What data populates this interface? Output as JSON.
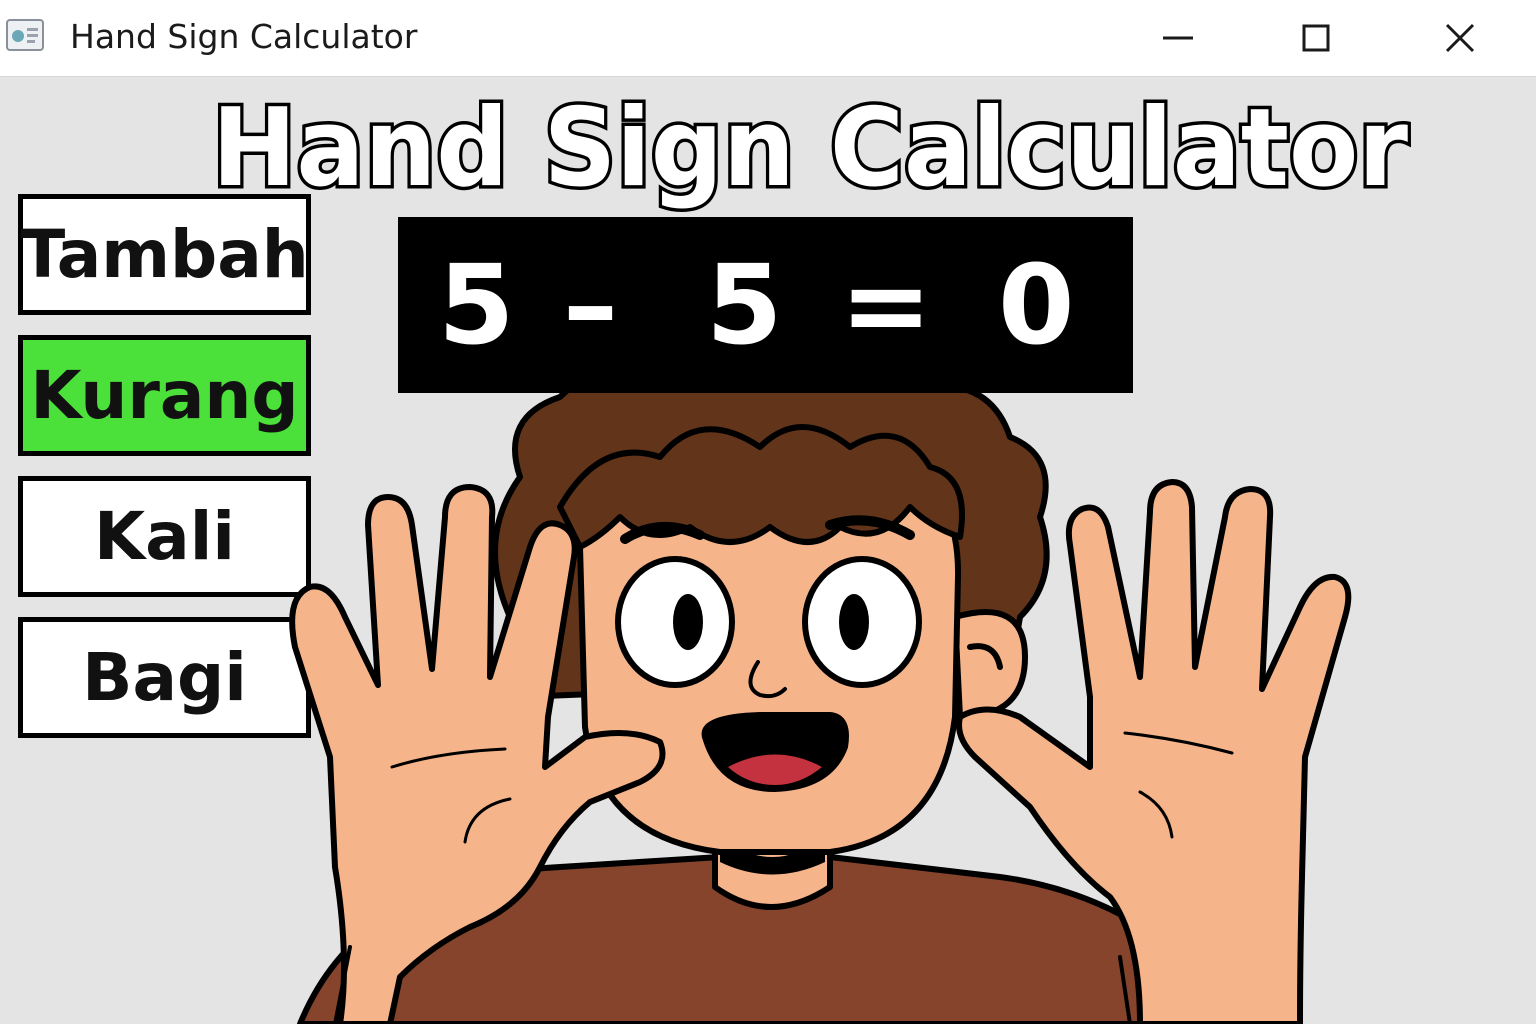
{
  "window": {
    "title": "Hand Sign Calculator",
    "icons": {
      "app": "app-icon",
      "minimize": "minimize-icon",
      "maximize": "maximize-icon",
      "close": "close-icon"
    }
  },
  "app": {
    "heading": "Hand Sign Calculator",
    "operations": [
      {
        "label": "Tambah",
        "selected": false
      },
      {
        "label": "Kurang",
        "selected": true
      },
      {
        "label": "Kali",
        "selected": false
      },
      {
        "label": "Bagi",
        "selected": false
      }
    ],
    "display": {
      "left": "5",
      "operator": "–",
      "right": "5",
      "equals": "=",
      "result": "0"
    }
  },
  "colors": {
    "selected_button": "#4ce03a",
    "display_bg": "#000000",
    "display_text": "#ffffff",
    "skin": "#f5b48a",
    "hair": "#62341a",
    "shirt": "#86442c",
    "background": "#e4e4e4"
  }
}
